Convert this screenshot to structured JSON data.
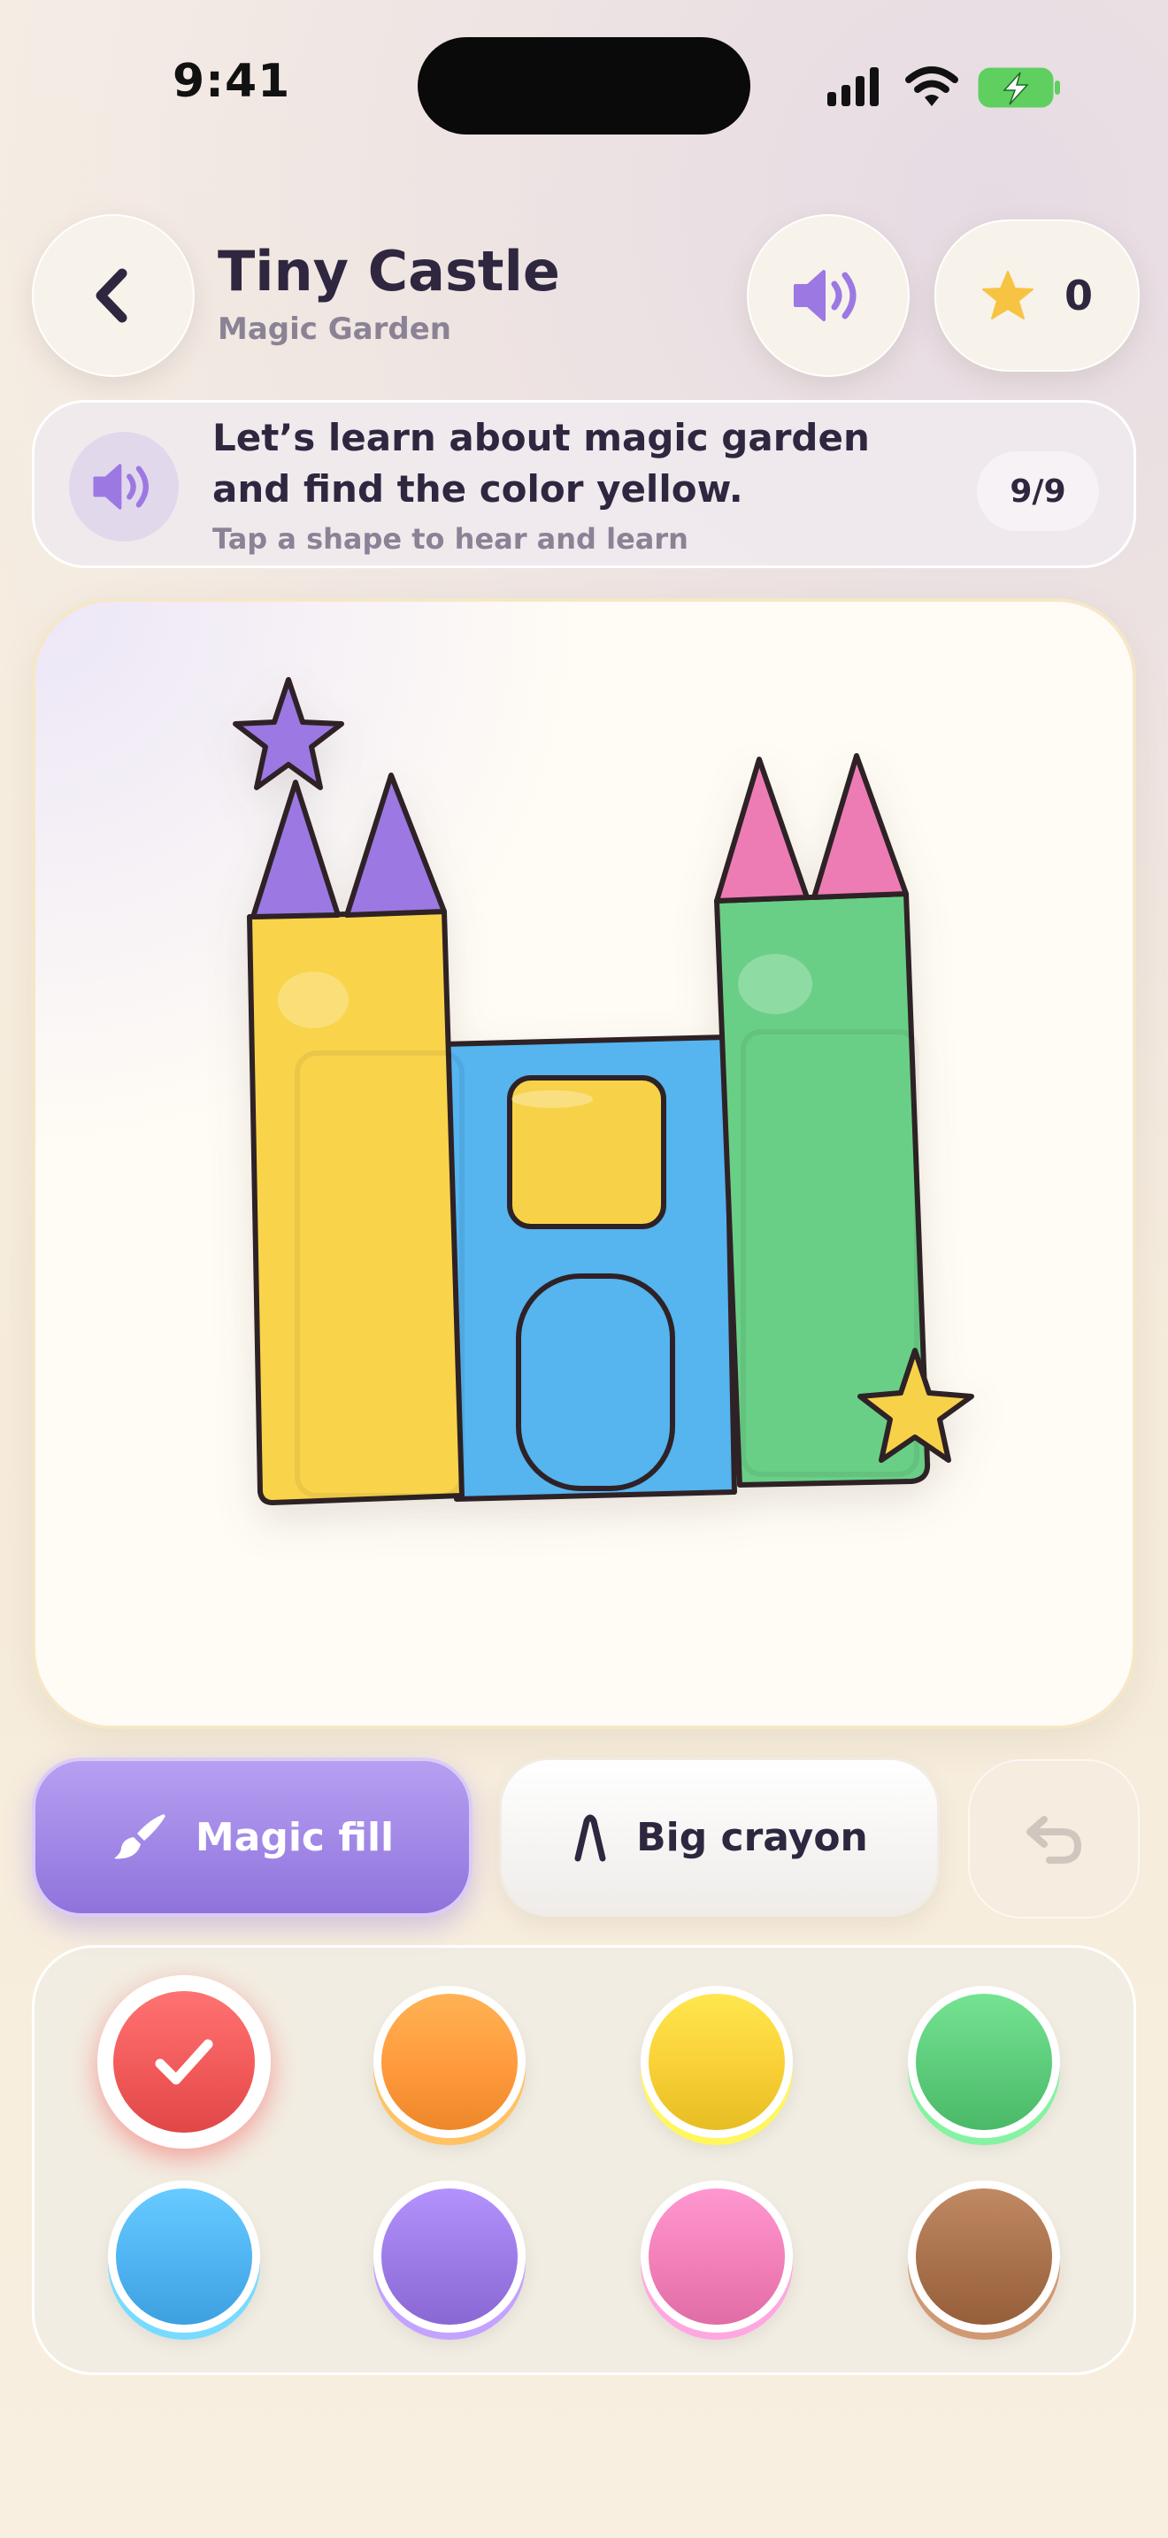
{
  "status_bar": {
    "time": "9:41"
  },
  "header": {
    "title": "Tiny Castle",
    "subtitle": "Magic Garden",
    "stars_count": "0"
  },
  "instruction": {
    "line1": "Let’s learn about magic garden",
    "line2": "and find the color yellow.",
    "hint": "Tap a shape to hear and learn",
    "progress": "9/9"
  },
  "tools": {
    "magic_fill_label": "Magic fill",
    "big_crayon_label": "Big crayon",
    "active_tool": "magic-fill"
  },
  "palette": {
    "selected": "red",
    "colors": [
      {
        "name": "red",
        "hex": "#f25a5a"
      },
      {
        "name": "orange",
        "hex": "#ff9a3c"
      },
      {
        "name": "yellow",
        "hex": "#f9cf36"
      },
      {
        "name": "green",
        "hex": "#5ccb7a"
      },
      {
        "name": "blue",
        "hex": "#4fb3f2"
      },
      {
        "name": "purple",
        "hex": "#9c7ae6"
      },
      {
        "name": "pink",
        "hex": "#f27fb8"
      },
      {
        "name": "brown",
        "hex": "#a8714c"
      }
    ]
  },
  "drawing": {
    "colors": {
      "left_tower": "#f9d44c",
      "middle_wall": "#56b4ef",
      "window": "#f7d24a",
      "door": "#56b4ef",
      "right_tower": "#6bcf86",
      "left_roofs": "#9c78e3",
      "right_roofs": "#ee7cb4",
      "left_star": "#9c78e3",
      "right_star": "#f7d24a",
      "outline": "#2f2226"
    }
  }
}
